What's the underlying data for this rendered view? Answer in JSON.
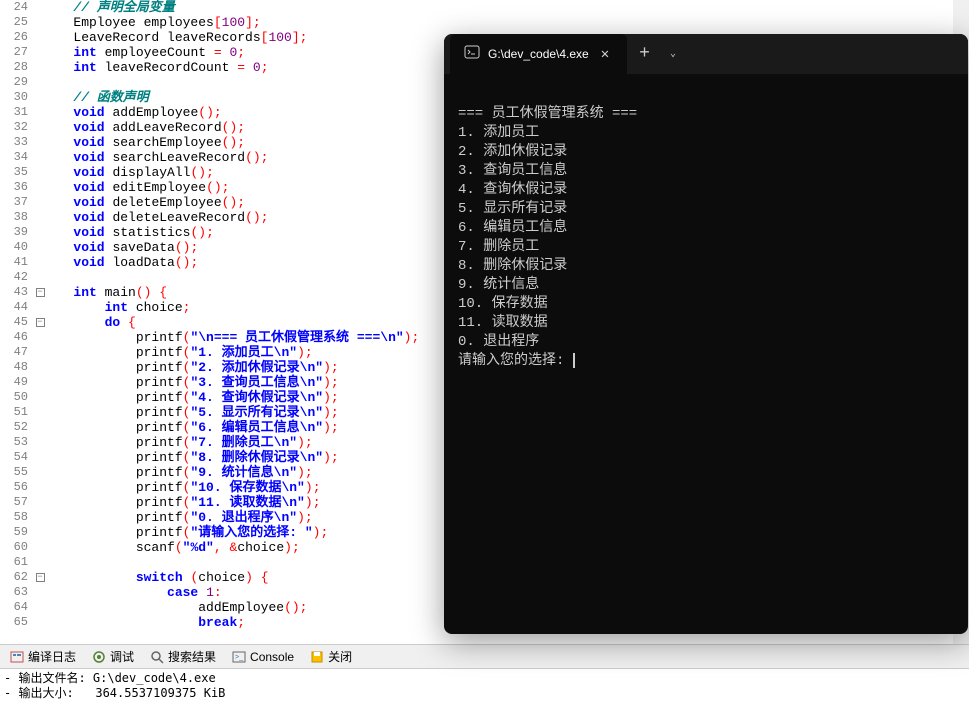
{
  "code_lines": [
    {
      "n": 24,
      "f": "",
      "html": "   <span class='comment'>// 声明全局变量</span>"
    },
    {
      "n": 25,
      "f": "",
      "html": "   <span class='ident'>Employee employees</span><span class='punct'>[</span><span class='num'>100</span><span class='punct'>];</span>"
    },
    {
      "n": 26,
      "f": "",
      "html": "   <span class='ident'>LeaveRecord leaveRecords</span><span class='punct'>[</span><span class='num'>100</span><span class='punct'>];</span>"
    },
    {
      "n": 27,
      "f": "",
      "html": "   <span class='kw'>int</span> <span class='ident'>employeeCount</span> <span class='punct'>=</span> <span class='num'>0</span><span class='punct'>;</span>"
    },
    {
      "n": 28,
      "f": "",
      "html": "   <span class='kw'>int</span> <span class='ident'>leaveRecordCount</span> <span class='punct'>=</span> <span class='num'>0</span><span class='punct'>;</span>"
    },
    {
      "n": 29,
      "f": "",
      "html": ""
    },
    {
      "n": 30,
      "f": "",
      "html": "   <span class='comment'>// 函数声明</span>"
    },
    {
      "n": 31,
      "f": "",
      "html": "   <span class='kw'>void</span> <span class='fn'>addEmployee</span><span class='paren'>()</span><span class='punct'>;</span>"
    },
    {
      "n": 32,
      "f": "",
      "html": "   <span class='kw'>void</span> <span class='fn'>addLeaveRecord</span><span class='paren'>()</span><span class='punct'>;</span>"
    },
    {
      "n": 33,
      "f": "",
      "html": "   <span class='kw'>void</span> <span class='fn'>searchEmployee</span><span class='paren'>()</span><span class='punct'>;</span>"
    },
    {
      "n": 34,
      "f": "",
      "html": "   <span class='kw'>void</span> <span class='fn'>searchLeaveRecord</span><span class='paren'>()</span><span class='punct'>;</span>"
    },
    {
      "n": 35,
      "f": "",
      "html": "   <span class='kw'>void</span> <span class='fn'>displayAll</span><span class='paren'>()</span><span class='punct'>;</span>"
    },
    {
      "n": 36,
      "f": "",
      "html": "   <span class='kw'>void</span> <span class='fn'>editEmployee</span><span class='paren'>()</span><span class='punct'>;</span>"
    },
    {
      "n": 37,
      "f": "",
      "html": "   <span class='kw'>void</span> <span class='fn'>deleteEmployee</span><span class='paren'>()</span><span class='punct'>;</span>"
    },
    {
      "n": 38,
      "f": "",
      "html": "   <span class='kw'>void</span> <span class='fn'>deleteLeaveRecord</span><span class='paren'>()</span><span class='punct'>;</span>"
    },
    {
      "n": 39,
      "f": "",
      "html": "   <span class='kw'>void</span> <span class='fn'>statistics</span><span class='paren'>()</span><span class='punct'>;</span>"
    },
    {
      "n": 40,
      "f": "",
      "html": "   <span class='kw'>void</span> <span class='fn'>saveData</span><span class='paren'>()</span><span class='punct'>;</span>"
    },
    {
      "n": 41,
      "f": "",
      "html": "   <span class='kw'>void</span> <span class='fn'>loadData</span><span class='paren'>()</span><span class='punct'>;</span>"
    },
    {
      "n": 42,
      "f": "",
      "html": ""
    },
    {
      "n": 43,
      "f": "-",
      "html": "   <span class='kw'>int</span> <span class='fn'>main</span><span class='paren'>()</span> <span class='punct'>{</span>"
    },
    {
      "n": 44,
      "f": "",
      "html": "       <span class='kw'>int</span> <span class='ident'>choice</span><span class='punct'>;</span>"
    },
    {
      "n": 45,
      "f": "-",
      "html": "       <span class='kw'>do</span> <span class='punct'>{</span>"
    },
    {
      "n": 46,
      "f": "",
      "html": "           <span class='fn'>printf</span><span class='paren'>(</span><span class='str'>\"\\n=== 员工休假管理系统 ===\\n\"</span><span class='paren'>)</span><span class='punct'>;</span>"
    },
    {
      "n": 47,
      "f": "",
      "html": "           <span class='fn'>printf</span><span class='paren'>(</span><span class='str'>\"1. 添加员工\\n\"</span><span class='paren'>)</span><span class='punct'>;</span>"
    },
    {
      "n": 48,
      "f": "",
      "html": "           <span class='fn'>printf</span><span class='paren'>(</span><span class='str'>\"2. 添加休假记录\\n\"</span><span class='paren'>)</span><span class='punct'>;</span>"
    },
    {
      "n": 49,
      "f": "",
      "html": "           <span class='fn'>printf</span><span class='paren'>(</span><span class='str'>\"3. 查询员工信息\\n\"</span><span class='paren'>)</span><span class='punct'>;</span>"
    },
    {
      "n": 50,
      "f": "",
      "html": "           <span class='fn'>printf</span><span class='paren'>(</span><span class='str'>\"4. 查询休假记录\\n\"</span><span class='paren'>)</span><span class='punct'>;</span>"
    },
    {
      "n": 51,
      "f": "",
      "html": "           <span class='fn'>printf</span><span class='paren'>(</span><span class='str'>\"5. 显示所有记录\\n\"</span><span class='paren'>)</span><span class='punct'>;</span>"
    },
    {
      "n": 52,
      "f": "",
      "html": "           <span class='fn'>printf</span><span class='paren'>(</span><span class='str'>\"6. 编辑员工信息\\n\"</span><span class='paren'>)</span><span class='punct'>;</span>"
    },
    {
      "n": 53,
      "f": "",
      "html": "           <span class='fn'>printf</span><span class='paren'>(</span><span class='str'>\"7. 删除员工\\n\"</span><span class='paren'>)</span><span class='punct'>;</span>"
    },
    {
      "n": 54,
      "f": "",
      "html": "           <span class='fn'>printf</span><span class='paren'>(</span><span class='str'>\"8. 删除休假记录\\n\"</span><span class='paren'>)</span><span class='punct'>;</span>"
    },
    {
      "n": 55,
      "f": "",
      "html": "           <span class='fn'>printf</span><span class='paren'>(</span><span class='str'>\"9. 统计信息\\n\"</span><span class='paren'>)</span><span class='punct'>;</span>"
    },
    {
      "n": 56,
      "f": "",
      "html": "           <span class='fn'>printf</span><span class='paren'>(</span><span class='str'>\"10. 保存数据\\n\"</span><span class='paren'>)</span><span class='punct'>;</span>"
    },
    {
      "n": 57,
      "f": "",
      "html": "           <span class='fn'>printf</span><span class='paren'>(</span><span class='str'>\"11. 读取数据\\n\"</span><span class='paren'>)</span><span class='punct'>;</span>"
    },
    {
      "n": 58,
      "f": "",
      "html": "           <span class='fn'>printf</span><span class='paren'>(</span><span class='str'>\"0. 退出程序\\n\"</span><span class='paren'>)</span><span class='punct'>;</span>"
    },
    {
      "n": 59,
      "f": "",
      "html": "           <span class='fn'>printf</span><span class='paren'>(</span><span class='str'>\"请输入您的选择: \"</span><span class='paren'>)</span><span class='punct'>;</span>"
    },
    {
      "n": 60,
      "f": "",
      "html": "           <span class='fn'>scanf</span><span class='paren'>(</span><span class='str'>\"%d\"</span><span class='punct'>,</span> <span class='punct'>&</span><span class='ident'>choice</span><span class='paren'>)</span><span class='punct'>;</span>"
    },
    {
      "n": 61,
      "f": "",
      "html": ""
    },
    {
      "n": 62,
      "f": "-",
      "html": "           <span class='kw'>switch</span> <span class='paren'>(</span><span class='ident'>choice</span><span class='paren'>)</span> <span class='punct'>{</span>"
    },
    {
      "n": 63,
      "f": "",
      "html": "               <span class='kw'>case</span> <span class='num'>1</span><span class='punct'>:</span>"
    },
    {
      "n": 64,
      "f": "",
      "html": "                   <span class='fn'>addEmployee</span><span class='paren'>()</span><span class='punct'>;</span>"
    },
    {
      "n": 65,
      "f": "",
      "html": "                   <span class='kw'>break</span><span class='punct'>;</span>"
    }
  ],
  "toolbar": {
    "compile_log": "编译日志",
    "debug": "调试",
    "search_results": "搜索结果",
    "console": "Console",
    "close": "关闭"
  },
  "output": {
    "line1": "- 输出文件名: G:\\dev_code\\4.exe",
    "line2": "- 输出大小:   364.5537109375 KiB"
  },
  "terminal": {
    "tab_title": "G:\\dev_code\\4.exe",
    "lines": [
      "",
      "=== 员工休假管理系统 ===",
      "1. 添加员工",
      "2. 添加休假记录",
      "3. 查询员工信息",
      "4. 查询休假记录",
      "5. 显示所有记录",
      "6. 编辑员工信息",
      "7. 删除员工",
      "8. 删除休假记录",
      "9. 统计信息",
      "10. 保存数据",
      "11. 读取数据",
      "0. 退出程序",
      "请输入您的选择: "
    ]
  }
}
